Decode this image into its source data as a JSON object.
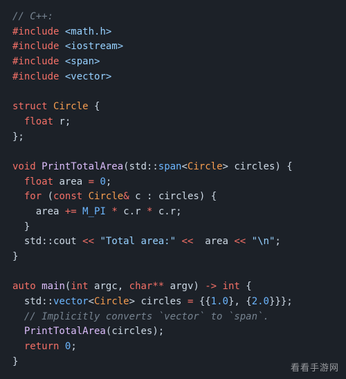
{
  "code": {
    "lines": [
      {
        "indent": 0,
        "tokens": [
          {
            "cls": "tok-comment",
            "t": "// C++:"
          }
        ]
      },
      {
        "indent": 0,
        "tokens": [
          {
            "cls": "tok-directive",
            "t": "#include"
          },
          {
            "cls": "",
            "t": " "
          },
          {
            "cls": "tok-header",
            "t": "<math.h>"
          }
        ]
      },
      {
        "indent": 0,
        "tokens": [
          {
            "cls": "tok-directive",
            "t": "#include"
          },
          {
            "cls": "",
            "t": " "
          },
          {
            "cls": "tok-header",
            "t": "<iostream>"
          }
        ]
      },
      {
        "indent": 0,
        "tokens": [
          {
            "cls": "tok-directive",
            "t": "#include"
          },
          {
            "cls": "",
            "t": " "
          },
          {
            "cls": "tok-header",
            "t": "<span>"
          }
        ]
      },
      {
        "indent": 0,
        "tokens": [
          {
            "cls": "tok-directive",
            "t": "#include"
          },
          {
            "cls": "",
            "t": " "
          },
          {
            "cls": "tok-header",
            "t": "<vector>"
          }
        ]
      },
      {
        "indent": 0,
        "tokens": []
      },
      {
        "indent": 0,
        "tokens": [
          {
            "cls": "tok-keyword",
            "t": "struct"
          },
          {
            "cls": "",
            "t": " "
          },
          {
            "cls": "tok-classname",
            "t": "Circle"
          },
          {
            "cls": "",
            "t": " "
          },
          {
            "cls": "tok-punct",
            "t": "{"
          }
        ]
      },
      {
        "indent": 1,
        "tokens": [
          {
            "cls": "tok-typekw",
            "t": "float"
          },
          {
            "cls": "",
            "t": " "
          },
          {
            "cls": "tok-ident",
            "t": "r"
          },
          {
            "cls": "tok-punct",
            "t": ";"
          }
        ]
      },
      {
        "indent": 0,
        "tokens": [
          {
            "cls": "tok-punct",
            "t": "};"
          }
        ]
      },
      {
        "indent": 0,
        "tokens": []
      },
      {
        "indent": 0,
        "tokens": [
          {
            "cls": "tok-typekw",
            "t": "void"
          },
          {
            "cls": "",
            "t": " "
          },
          {
            "cls": "tok-func",
            "t": "PrintTotalArea"
          },
          {
            "cls": "tok-punct",
            "t": "("
          },
          {
            "cls": "tok-ns",
            "t": "std"
          },
          {
            "cls": "tok-punct",
            "t": "::"
          },
          {
            "cls": "tok-type",
            "t": "span"
          },
          {
            "cls": "tok-punct",
            "t": "<"
          },
          {
            "cls": "tok-classname",
            "t": "Circle"
          },
          {
            "cls": "tok-punct",
            "t": ">"
          },
          {
            "cls": "",
            "t": " "
          },
          {
            "cls": "tok-ident",
            "t": "circles"
          },
          {
            "cls": "tok-punct",
            "t": ")"
          },
          {
            "cls": "",
            "t": " "
          },
          {
            "cls": "tok-punct",
            "t": "{"
          }
        ]
      },
      {
        "indent": 1,
        "tokens": [
          {
            "cls": "tok-typekw",
            "t": "float"
          },
          {
            "cls": "",
            "t": " "
          },
          {
            "cls": "tok-ident",
            "t": "area"
          },
          {
            "cls": "",
            "t": " "
          },
          {
            "cls": "tok-op",
            "t": "="
          },
          {
            "cls": "",
            "t": " "
          },
          {
            "cls": "tok-number",
            "t": "0"
          },
          {
            "cls": "tok-punct",
            "t": ";"
          }
        ]
      },
      {
        "indent": 1,
        "tokens": [
          {
            "cls": "tok-keyword",
            "t": "for"
          },
          {
            "cls": "",
            "t": " "
          },
          {
            "cls": "tok-punct",
            "t": "("
          },
          {
            "cls": "tok-keyword",
            "t": "const"
          },
          {
            "cls": "",
            "t": " "
          },
          {
            "cls": "tok-classname",
            "t": "Circle"
          },
          {
            "cls": "tok-op",
            "t": "&"
          },
          {
            "cls": "",
            "t": " "
          },
          {
            "cls": "tok-ident",
            "t": "c"
          },
          {
            "cls": "",
            "t": " "
          },
          {
            "cls": "tok-punct",
            "t": ":"
          },
          {
            "cls": "",
            "t": " "
          },
          {
            "cls": "tok-ident",
            "t": "circles"
          },
          {
            "cls": "tok-punct",
            "t": ")"
          },
          {
            "cls": "",
            "t": " "
          },
          {
            "cls": "tok-punct",
            "t": "{"
          }
        ]
      },
      {
        "indent": 2,
        "tokens": [
          {
            "cls": "tok-ident",
            "t": "area"
          },
          {
            "cls": "",
            "t": " "
          },
          {
            "cls": "tok-op",
            "t": "+="
          },
          {
            "cls": "",
            "t": " "
          },
          {
            "cls": "tok-const",
            "t": "M_PI"
          },
          {
            "cls": "",
            "t": " "
          },
          {
            "cls": "tok-op",
            "t": "*"
          },
          {
            "cls": "",
            "t": " "
          },
          {
            "cls": "tok-ident",
            "t": "c"
          },
          {
            "cls": "tok-punct",
            "t": "."
          },
          {
            "cls": "tok-ident",
            "t": "r"
          },
          {
            "cls": "",
            "t": " "
          },
          {
            "cls": "tok-op",
            "t": "*"
          },
          {
            "cls": "",
            "t": " "
          },
          {
            "cls": "tok-ident",
            "t": "c"
          },
          {
            "cls": "tok-punct",
            "t": "."
          },
          {
            "cls": "tok-ident",
            "t": "r"
          },
          {
            "cls": "tok-punct",
            "t": ";"
          }
        ]
      },
      {
        "indent": 1,
        "tokens": [
          {
            "cls": "tok-punct",
            "t": "}"
          }
        ]
      },
      {
        "indent": 1,
        "tokens": [
          {
            "cls": "tok-ns",
            "t": "std"
          },
          {
            "cls": "tok-punct",
            "t": "::"
          },
          {
            "cls": "tok-ident",
            "t": "cout"
          },
          {
            "cls": "",
            "t": " "
          },
          {
            "cls": "tok-op",
            "t": "<<"
          },
          {
            "cls": "",
            "t": " "
          },
          {
            "cls": "tok-string",
            "t": "\"Total area:\""
          },
          {
            "cls": "",
            "t": " "
          },
          {
            "cls": "tok-op",
            "t": "<<"
          },
          {
            "cls": "",
            "t": "  "
          },
          {
            "cls": "tok-ident",
            "t": "area"
          },
          {
            "cls": "",
            "t": " "
          },
          {
            "cls": "tok-op",
            "t": "<<"
          },
          {
            "cls": "",
            "t": " "
          },
          {
            "cls": "tok-string",
            "t": "\"\\n\""
          },
          {
            "cls": "tok-punct",
            "t": ";"
          }
        ]
      },
      {
        "indent": 0,
        "tokens": [
          {
            "cls": "tok-punct",
            "t": "}"
          }
        ]
      },
      {
        "indent": 0,
        "tokens": []
      },
      {
        "indent": 0,
        "tokens": [
          {
            "cls": "tok-keyword",
            "t": "auto"
          },
          {
            "cls": "",
            "t": " "
          },
          {
            "cls": "tok-func",
            "t": "main"
          },
          {
            "cls": "tok-punct",
            "t": "("
          },
          {
            "cls": "tok-typekw",
            "t": "int"
          },
          {
            "cls": "",
            "t": " "
          },
          {
            "cls": "tok-ident",
            "t": "argc"
          },
          {
            "cls": "tok-punct",
            "t": ","
          },
          {
            "cls": "",
            "t": " "
          },
          {
            "cls": "tok-typekw",
            "t": "char"
          },
          {
            "cls": "tok-op",
            "t": "**"
          },
          {
            "cls": "",
            "t": " "
          },
          {
            "cls": "tok-ident",
            "t": "argv"
          },
          {
            "cls": "tok-punct",
            "t": ")"
          },
          {
            "cls": "",
            "t": " "
          },
          {
            "cls": "tok-op",
            "t": "->"
          },
          {
            "cls": "",
            "t": " "
          },
          {
            "cls": "tok-typekw",
            "t": "int"
          },
          {
            "cls": "",
            "t": " "
          },
          {
            "cls": "tok-punct",
            "t": "{"
          }
        ]
      },
      {
        "indent": 1,
        "tokens": [
          {
            "cls": "tok-ns",
            "t": "std"
          },
          {
            "cls": "tok-punct",
            "t": "::"
          },
          {
            "cls": "tok-type",
            "t": "vector"
          },
          {
            "cls": "tok-punct",
            "t": "<"
          },
          {
            "cls": "tok-classname",
            "t": "Circle"
          },
          {
            "cls": "tok-punct",
            "t": ">"
          },
          {
            "cls": "",
            "t": " "
          },
          {
            "cls": "tok-ident",
            "t": "circles"
          },
          {
            "cls": "",
            "t": " "
          },
          {
            "cls": "tok-op",
            "t": "="
          },
          {
            "cls": "",
            "t": " "
          },
          {
            "cls": "tok-punct",
            "t": "{{"
          },
          {
            "cls": "tok-number",
            "t": "1.0"
          },
          {
            "cls": "tok-punct",
            "t": "}, {"
          },
          {
            "cls": "tok-number",
            "t": "2.0"
          },
          {
            "cls": "tok-punct",
            "t": "}}};"
          }
        ]
      },
      {
        "indent": 1,
        "tokens": [
          {
            "cls": "tok-comment",
            "t": "// Implicitly converts `vector` to `span`."
          }
        ]
      },
      {
        "indent": 1,
        "tokens": [
          {
            "cls": "tok-func",
            "t": "PrintTotalArea"
          },
          {
            "cls": "tok-punct",
            "t": "("
          },
          {
            "cls": "tok-ident",
            "t": "circles"
          },
          {
            "cls": "tok-punct",
            "t": ");"
          }
        ]
      },
      {
        "indent": 1,
        "tokens": [
          {
            "cls": "tok-keyword",
            "t": "return"
          },
          {
            "cls": "",
            "t": " "
          },
          {
            "cls": "tok-number",
            "t": "0"
          },
          {
            "cls": "tok-punct",
            "t": ";"
          }
        ]
      },
      {
        "indent": 0,
        "tokens": [
          {
            "cls": "tok-punct",
            "t": "}"
          }
        ]
      }
    ]
  },
  "indent_unit": "  ",
  "watermark": "看看手游网"
}
